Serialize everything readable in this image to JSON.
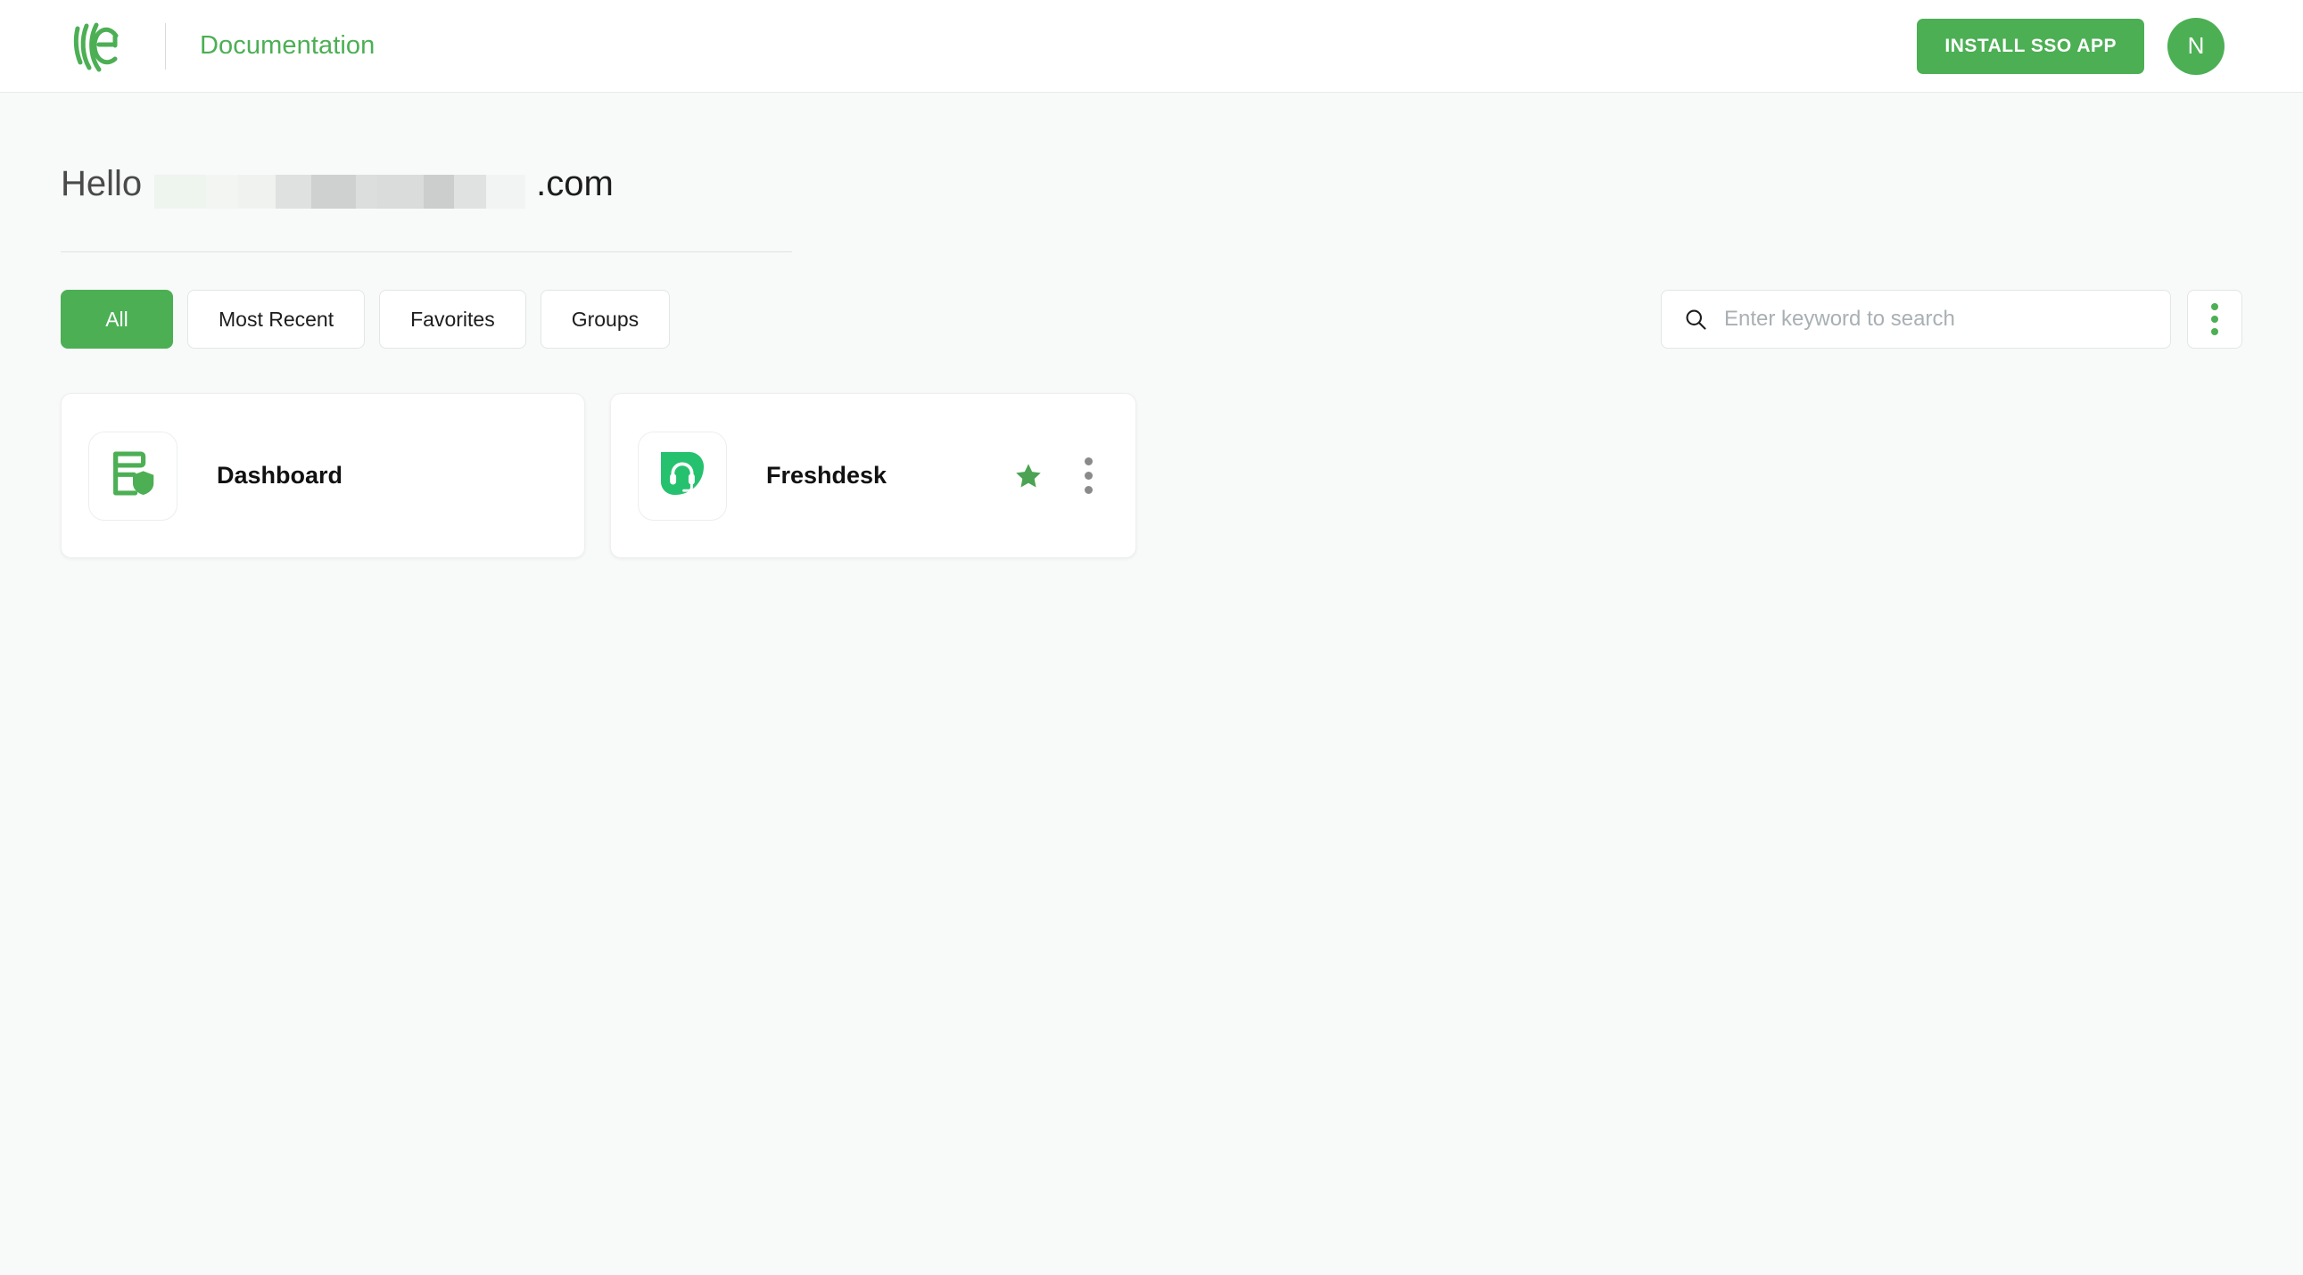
{
  "header": {
    "logo_icon": "miniorange-logo-icon",
    "title": "Documentation",
    "install_button": "INSTALL SSO APP",
    "avatar_initial": "N"
  },
  "greeting": {
    "hello": "Hello",
    "redacted_value": "",
    "suffix": ".com"
  },
  "filters": {
    "tabs": [
      {
        "label": "All",
        "active": true
      },
      {
        "label": "Most Recent",
        "active": false
      },
      {
        "label": "Favorites",
        "active": false
      },
      {
        "label": "Groups",
        "active": false
      }
    ],
    "search": {
      "icon": "search-icon",
      "placeholder": "Enter keyword to search",
      "value": ""
    },
    "overflow_menu_icon": "kebab-menu-icon"
  },
  "apps": [
    {
      "name": "Dashboard",
      "icon": "dashboard-shield-icon",
      "favorite": false,
      "has_menu": false
    },
    {
      "name": "Freshdesk",
      "icon": "freshdesk-headset-icon",
      "favorite": true,
      "has_menu": true
    }
  ],
  "colors": {
    "brand_green": "#4caf54",
    "freshdesk_green": "#25c16f",
    "page_background": "#f8f9f9",
    "card_background": "#ffffff",
    "star_green": "#4ca353",
    "kebab_gray": "#8a8a8a"
  },
  "redaction_blocks": [
    {
      "width": 58,
      "color": "#eef4ee"
    },
    {
      "width": 36,
      "color": "#f2f5f2"
    },
    {
      "width": 42,
      "color": "#f0f2f0"
    },
    {
      "width": 40,
      "color": "#dfe0e0"
    },
    {
      "width": 50,
      "color": "#cfd0d0"
    },
    {
      "width": 24,
      "color": "#dcdddd"
    },
    {
      "width": 52,
      "color": "#dadbdb"
    },
    {
      "width": 34,
      "color": "#cccdcd"
    },
    {
      "width": 36,
      "color": "#e0e1e1"
    },
    {
      "width": 44,
      "color": "#f2f3f3"
    }
  ]
}
